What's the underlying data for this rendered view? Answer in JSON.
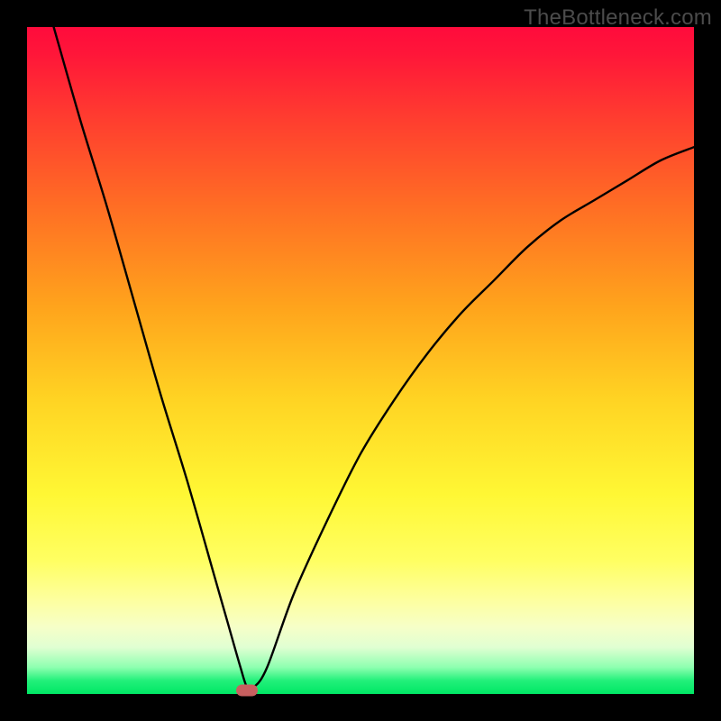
{
  "watermark": "TheBottleneck.com",
  "colors": {
    "frame": "#000000",
    "curve": "#000000",
    "marker": "#c86060"
  },
  "chart_data": {
    "type": "line",
    "title": "",
    "xlabel": "",
    "ylabel": "",
    "xlim": [
      0,
      100
    ],
    "ylim": [
      0,
      100
    ],
    "grid": false,
    "legend": false,
    "background": "vertical-gradient red→yellow→green",
    "series": [
      {
        "name": "bottleneck-curve",
        "x": [
          4,
          8,
          12,
          16,
          20,
          24,
          28,
          30,
          32,
          33,
          34,
          36,
          40,
          45,
          50,
          55,
          60,
          65,
          70,
          75,
          80,
          85,
          90,
          95,
          100
        ],
        "y": [
          100,
          86,
          73,
          59,
          45,
          32,
          18,
          11,
          4,
          1,
          1,
          4,
          15,
          26,
          36,
          44,
          51,
          57,
          62,
          67,
          71,
          74,
          77,
          80,
          82
        ]
      }
    ],
    "annotations": [
      {
        "type": "marker",
        "x": 33,
        "y": 0.5,
        "shape": "pill",
        "color": "#c86060"
      }
    ]
  }
}
